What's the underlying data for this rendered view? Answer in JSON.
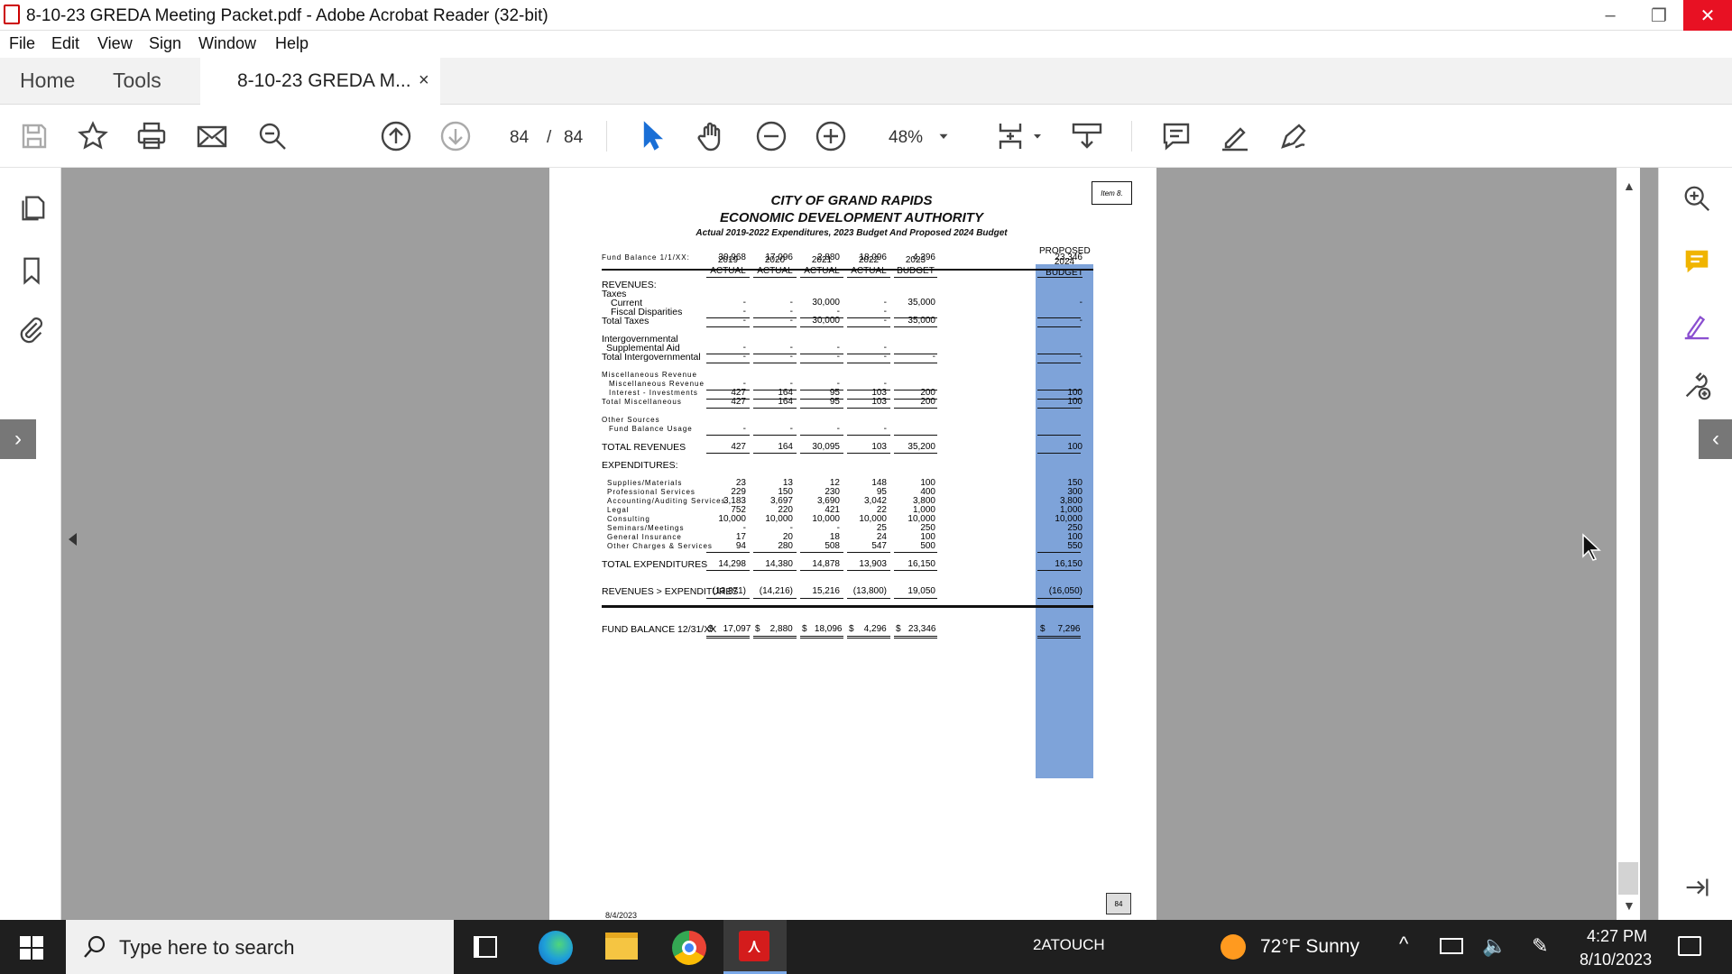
{
  "window": {
    "title": "8-10-23 GREDA Meeting Packet.pdf - Adobe Acrobat Reader (32-bit)",
    "minimize_glyph": "–",
    "restore_glyph": "❐",
    "close_glyph": "✕"
  },
  "menu": [
    "File",
    "Edit",
    "View",
    "Sign",
    "Window",
    "Help"
  ],
  "tabs": {
    "home": "Home",
    "tools": "Tools",
    "document": "8-10-23 GREDA M...",
    "close": "×"
  },
  "toolbar": {
    "page_current": "84",
    "page_sep": "/",
    "page_total": "84",
    "zoom": "48%"
  },
  "report": {
    "title1": "CITY OF GRAND RAPIDS",
    "title2": "ECONOMIC DEVELOPMENT AUTHORITY",
    "title3": "Actual 2019-2022 Expenditures, 2023 Budget And Proposed 2024 Budget",
    "item_box": "Item 8.",
    "col_headers": [
      [
        "2019",
        "ACTUAL"
      ],
      [
        "2020",
        "ACTUAL"
      ],
      [
        "2021",
        "ACTUAL"
      ],
      [
        "2022",
        "ACTUAL"
      ],
      [
        "2023",
        "BUDGET"
      ],
      [
        "PROPOSED",
        "2024",
        "BUDGET"
      ]
    ],
    "rows": [
      {
        "label": "Fund Balance 1/1/XX:",
        "values": [
          "30,968",
          "17,096",
          "2,880",
          "18,096",
          "4,296",
          "23,346"
        ]
      },
      {
        "label": "REVENUES:",
        "values": []
      },
      {
        "label": "Taxes",
        "values": []
      },
      {
        "label": "Current",
        "values": [
          "-",
          "-",
          "30,000",
          "-",
          "35,000",
          "-"
        ]
      },
      {
        "label": "Fiscal Disparities",
        "values": [
          "-",
          "-",
          "-",
          "-",
          "",
          ""
        ]
      },
      {
        "label": "Total Taxes",
        "values": [
          "-",
          "-",
          "30,000",
          "-",
          "35,000",
          "-"
        ]
      },
      {
        "label": "Intergovernmental",
        "values": []
      },
      {
        "label": "Supplemental Aid",
        "values": [
          "-",
          "-",
          "-",
          "-",
          "",
          ""
        ]
      },
      {
        "label": "Total Intergovernmental",
        "values": [
          "-",
          "-",
          "-",
          "-",
          "-",
          "-"
        ]
      },
      {
        "label": "Miscellaneous Revenue",
        "values": []
      },
      {
        "label": "Miscellaneous Revenue",
        "values": [
          "-",
          "-",
          "-",
          "-",
          "",
          ""
        ]
      },
      {
        "label": "Interest - Investments",
        "values": [
          "427",
          "164",
          "95",
          "103",
          "200",
          "100"
        ]
      },
      {
        "label": "Total Miscellaneous",
        "values": [
          "427",
          "164",
          "95",
          "103",
          "200",
          "100"
        ]
      },
      {
        "label": "Other Sources",
        "values": []
      },
      {
        "label": "Fund Balance Usage",
        "values": [
          "-",
          "-",
          "-",
          "-",
          "",
          ""
        ]
      },
      {
        "label": "TOTAL REVENUES",
        "values": [
          "427",
          "164",
          "30,095",
          "103",
          "35,200",
          "100"
        ]
      },
      {
        "label": "EXPENDITURES:",
        "values": []
      },
      {
        "label": "Supplies/Materials",
        "values": [
          "23",
          "13",
          "12",
          "148",
          "100",
          "150"
        ]
      },
      {
        "label": "Professional Services",
        "values": [
          "229",
          "150",
          "230",
          "95",
          "400",
          "300"
        ]
      },
      {
        "label": "Accounting/Auditing Services",
        "values": [
          "3,183",
          "3,697",
          "3,690",
          "3,042",
          "3,800",
          "3,800"
        ]
      },
      {
        "label": "Legal",
        "values": [
          "752",
          "220",
          "421",
          "22",
          "1,000",
          "1,000"
        ]
      },
      {
        "label": "Consulting",
        "values": [
          "10,000",
          "10,000",
          "10,000",
          "10,000",
          "10,000",
          "10,000"
        ]
      },
      {
        "label": "Seminars/Meetings",
        "values": [
          "-",
          "-",
          "-",
          "25",
          "250",
          "250"
        ]
      },
      {
        "label": "General Insurance",
        "values": [
          "17",
          "20",
          "18",
          "24",
          "100",
          "100"
        ]
      },
      {
        "label": "Other Charges & Services",
        "values": [
          "94",
          "280",
          "508",
          "547",
          "500",
          "550"
        ]
      },
      {
        "label": "TOTAL EXPENDITURES",
        "values": [
          "14,298",
          "14,380",
          "14,878",
          "13,903",
          "16,150",
          "16,150"
        ]
      },
      {
        "label": "REVENUES > EXPENDITURES",
        "values": [
          "(13,871)",
          "(14,216)",
          "15,216",
          "(13,800)",
          "19,050",
          "(16,050)"
        ]
      },
      {
        "label": "FUND BALANCE 12/31/XX",
        "values": [
          "$    17,097",
          "$    2,880",
          "$   18,096",
          "$    4,296",
          "$   23,346",
          "$     7,296"
        ]
      }
    ],
    "footer_date": "8/4/2023",
    "footer_page": "84"
  },
  "taskbar": {
    "search_placeholder": "Type here to search",
    "center_label": "2ATOUCH",
    "weather": "72°F  Sunny",
    "time": "4:27 PM",
    "date": "8/10/2023"
  }
}
